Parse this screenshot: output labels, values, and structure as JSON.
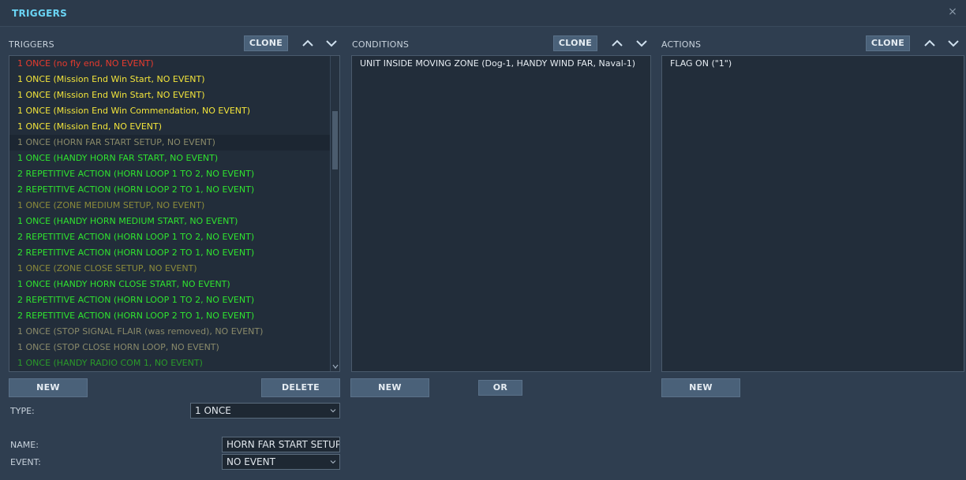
{
  "window": {
    "title": "TRIGGERS",
    "close_icon": "×"
  },
  "colors": {
    "red": "#e63b2e",
    "yellow": "#f2e43a",
    "green": "#2fe32f",
    "gray": "#8a8a6a",
    "olive": "#8c8b3a",
    "dark_green": "#2a9a2a",
    "white": "#e6ecf2"
  },
  "triggers": {
    "label": "TRIGGERS",
    "clone_label": "CLONE",
    "new_label": "NEW",
    "delete_label": "DELETE",
    "items": [
      {
        "text": "1 ONCE (no fly end, NO EVENT)",
        "color": "#e63b2e"
      },
      {
        "text": "1 ONCE (Mission End Win Start, NO EVENT)",
        "color": "#f2e43a"
      },
      {
        "text": "1 ONCE (Mission End Win Start, NO EVENT)",
        "color": "#f2e43a"
      },
      {
        "text": "1 ONCE (Mission End Win Commendation, NO EVENT)",
        "color": "#f2e43a"
      },
      {
        "text": "1 ONCE (Mission End, NO EVENT)",
        "color": "#f2e43a"
      },
      {
        "text": "1 ONCE (HORN FAR START SETUP, NO EVENT)",
        "color": "#8a8a6a",
        "selected": true
      },
      {
        "text": "1 ONCE (HANDY HORN FAR START, NO EVENT)",
        "color": "#2fe32f"
      },
      {
        "text": "2 REPETITIVE ACTION (HORN LOOP 1 TO 2, NO EVENT)",
        "color": "#2fe32f"
      },
      {
        "text": "2 REPETITIVE ACTION (HORN LOOP 2 TO 1, NO EVENT)",
        "color": "#2fe32f"
      },
      {
        "text": "1 ONCE (ZONE MEDIUM SETUP, NO EVENT)",
        "color": "#8c8b3a"
      },
      {
        "text": "1 ONCE (HANDY HORN MEDIUM START, NO EVENT)",
        "color": "#2fe32f"
      },
      {
        "text": "2 REPETITIVE ACTION (HORN LOOP 1 TO 2, NO EVENT)",
        "color": "#2fe32f"
      },
      {
        "text": "2 REPETITIVE ACTION (HORN LOOP 2 TO 1, NO EVENT)",
        "color": "#2fe32f"
      },
      {
        "text": "1 ONCE (ZONE CLOSE SETUP, NO EVENT)",
        "color": "#8c8b3a"
      },
      {
        "text": "1 ONCE (HANDY HORN CLOSE START, NO EVENT)",
        "color": "#2fe32f"
      },
      {
        "text": "2 REPETITIVE ACTION (HORN LOOP 1 TO 2, NO EVENT)",
        "color": "#2fe32f"
      },
      {
        "text": "2 REPETITIVE ACTION (HORN LOOP 2 TO 1, NO EVENT)",
        "color": "#2fe32f"
      },
      {
        "text": "1 ONCE (STOP SIGNAL FLAIR (was removed), NO EVENT)",
        "color": "#8a8a6a"
      },
      {
        "text": "1 ONCE (STOP CLOSE HORN LOOP, NO EVENT)",
        "color": "#8a8a6a"
      },
      {
        "text": "1 ONCE (HANDY RADIO COM 1, NO EVENT)",
        "color": "#2a9a2a"
      }
    ]
  },
  "conditions": {
    "label": "CONDITIONS",
    "clone_label": "CLONE",
    "new_label": "NEW",
    "or_label": "OR",
    "items": [
      {
        "text": "UNIT INSIDE MOVING ZONE (Dog-1, HANDY WIND FAR, Naval-1)",
        "color": "#e6ecf2"
      }
    ]
  },
  "actions": {
    "label": "ACTIONS",
    "clone_label": "CLONE",
    "new_label": "NEW",
    "items": [
      {
        "text": "FLAG ON (\"1\")",
        "color": "#e6ecf2"
      }
    ]
  },
  "form": {
    "type_label": "TYPE:",
    "type_value": "1 ONCE",
    "name_label": "NAME:",
    "name_value": "HORN FAR START SETUP",
    "event_label": "EVENT:",
    "event_value": "NO EVENT"
  },
  "icons": {
    "up": "chevron-up-icon",
    "down": "chevron-down-icon",
    "close": "close-icon",
    "dropdown": "chevron-down-icon"
  }
}
